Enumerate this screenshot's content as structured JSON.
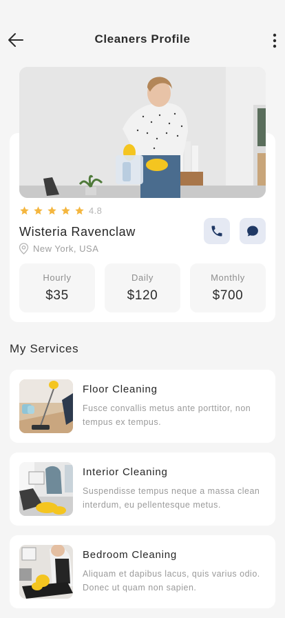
{
  "header": {
    "title": "Cleaners Profile",
    "back_icon": "arrow-left-icon",
    "more_icon": "more-vertical-icon"
  },
  "profile": {
    "rating_stars": 5,
    "rating_value": "4.8",
    "name": "Wisteria Ravenclaw",
    "location": "New York, USA",
    "star_color": "#f4b63f",
    "accent_color": "#1f3864",
    "action_bg": "#e5e9f3"
  },
  "pricing": [
    {
      "label": "Hourly",
      "value": "$35"
    },
    {
      "label": "Daily",
      "value": "$120"
    },
    {
      "label": "Monthly",
      "value": "$700"
    }
  ],
  "services_title": "My Services",
  "services": [
    {
      "name": "Floor Cleaning",
      "description": "Fusce convallis metus ante porttitor, non tempus ex tempus."
    },
    {
      "name": "Interior Cleaning",
      "description": "Suspendisse tempus neque a massa clean interdum, eu pellentesque metus."
    },
    {
      "name": "Bedroom Cleaning",
      "description": "Aliquam et dapibus lacus, quis varius odio. Donec ut quam non sapien."
    }
  ]
}
